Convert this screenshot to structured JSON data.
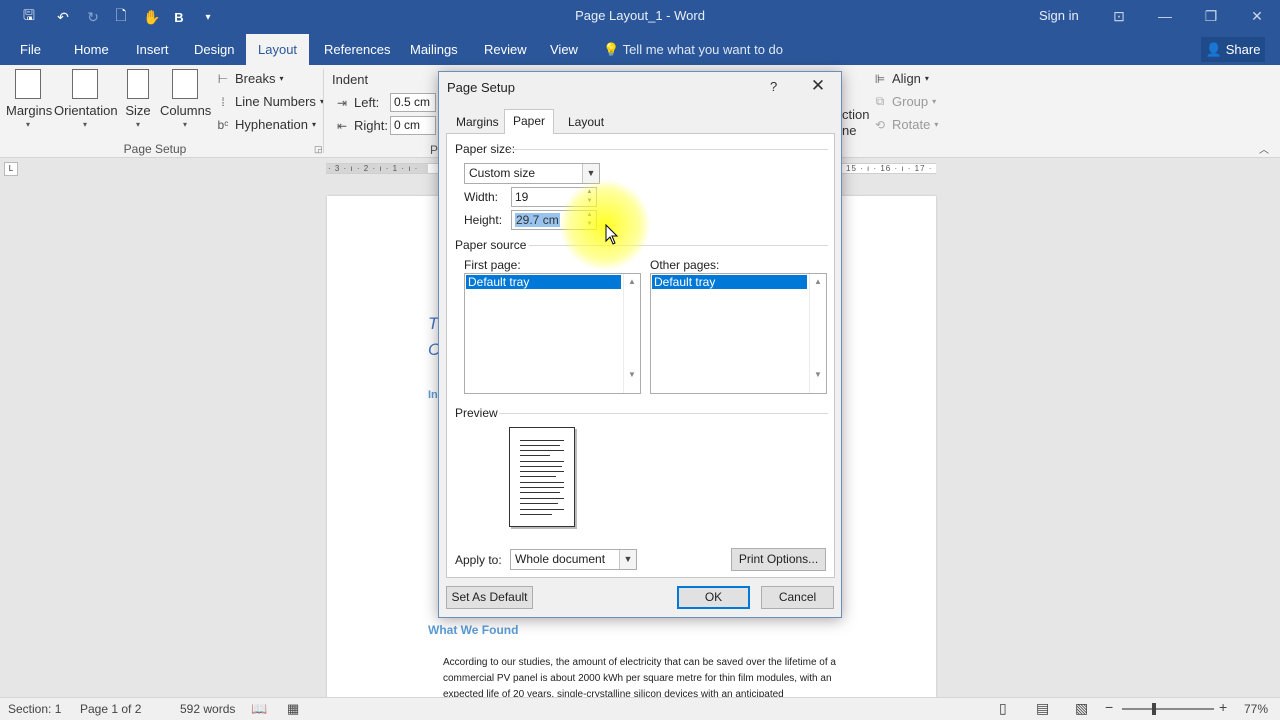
{
  "window": {
    "title": "Page Layout_1 - Word",
    "signin": "Sign in",
    "controls": {
      "ribbon_display": "⊡",
      "minimize": "—",
      "restore": "❐",
      "close": "✕"
    }
  },
  "quick_access": {
    "save": "🖫",
    "undo": "↶",
    "redo": "↻",
    "new": "🗋",
    "touch": "✋",
    "bold": "B",
    "customize": "▾"
  },
  "tabs": [
    "File",
    "Home",
    "Insert",
    "Design",
    "Layout",
    "References",
    "Mailings",
    "Review",
    "View"
  ],
  "tell_me": "Tell me what you want to do",
  "share": "Share",
  "ribbon": {
    "page_setup": {
      "margins": "Margins",
      "orientation": "Orientation",
      "size": "Size",
      "columns": "Columns",
      "breaks": "Breaks",
      "line_numbers": "Line Numbers",
      "hyphenation": "Hyphenation",
      "group_label": "Page Setup"
    },
    "paragraph": {
      "indent": "Indent",
      "left_label": "Left:",
      "left_value": "0.5 cm",
      "right_label": "Right:",
      "right_value": "0 cm",
      "cut_label": "Pa"
    },
    "arrange": {
      "align": "Align",
      "group": "Group",
      "rotate": "Rotate",
      "selection_pane_line1": "ction",
      "selection_pane_line2": "ne"
    }
  },
  "ruler": {
    "left_ticks": "· 3 · ı · 2 · ı · 1 · ı ·",
    "right_ticks": "15 · ı · 16 · ı · 17 ·",
    "corner": "L"
  },
  "document": {
    "frag_1": "T",
    "frag_2": "C",
    "frag_3": "In",
    "heading": "What We Found",
    "body": "According to our studies, the amount of electricity that can be saved over the lifetime of a commercial PV panel is about 2000 kWh per square metre for thin film modules, with an expected life of 20 years, single-crystalline silicon devices with an anticipated"
  },
  "status_bar": {
    "section": "Section: 1",
    "page": "Page 1 of 2",
    "words": "592 words",
    "zoom": "77%"
  },
  "dialog": {
    "title": "Page Setup",
    "help": "?",
    "close": "✕",
    "tabs": [
      "Margins",
      "Paper",
      "Layout"
    ],
    "active_tab": "Paper",
    "paper_size_label": "Paper size:",
    "paper_size_value": "Custom size",
    "width_label": "Width:",
    "width_value": "19",
    "height_label": "Height:",
    "height_value": "29.7 cm",
    "paper_source_label": "Paper source",
    "first_page_label": "First page:",
    "first_page_item": "Default tray",
    "other_pages_label": "Other pages:",
    "other_pages_item": "Default tray",
    "preview_label": "Preview",
    "apply_to_label": "Apply to:",
    "apply_to_value": "Whole document",
    "print_options": "Print Options...",
    "set_as_default": "Set As Default",
    "ok": "OK",
    "cancel": "Cancel"
  }
}
